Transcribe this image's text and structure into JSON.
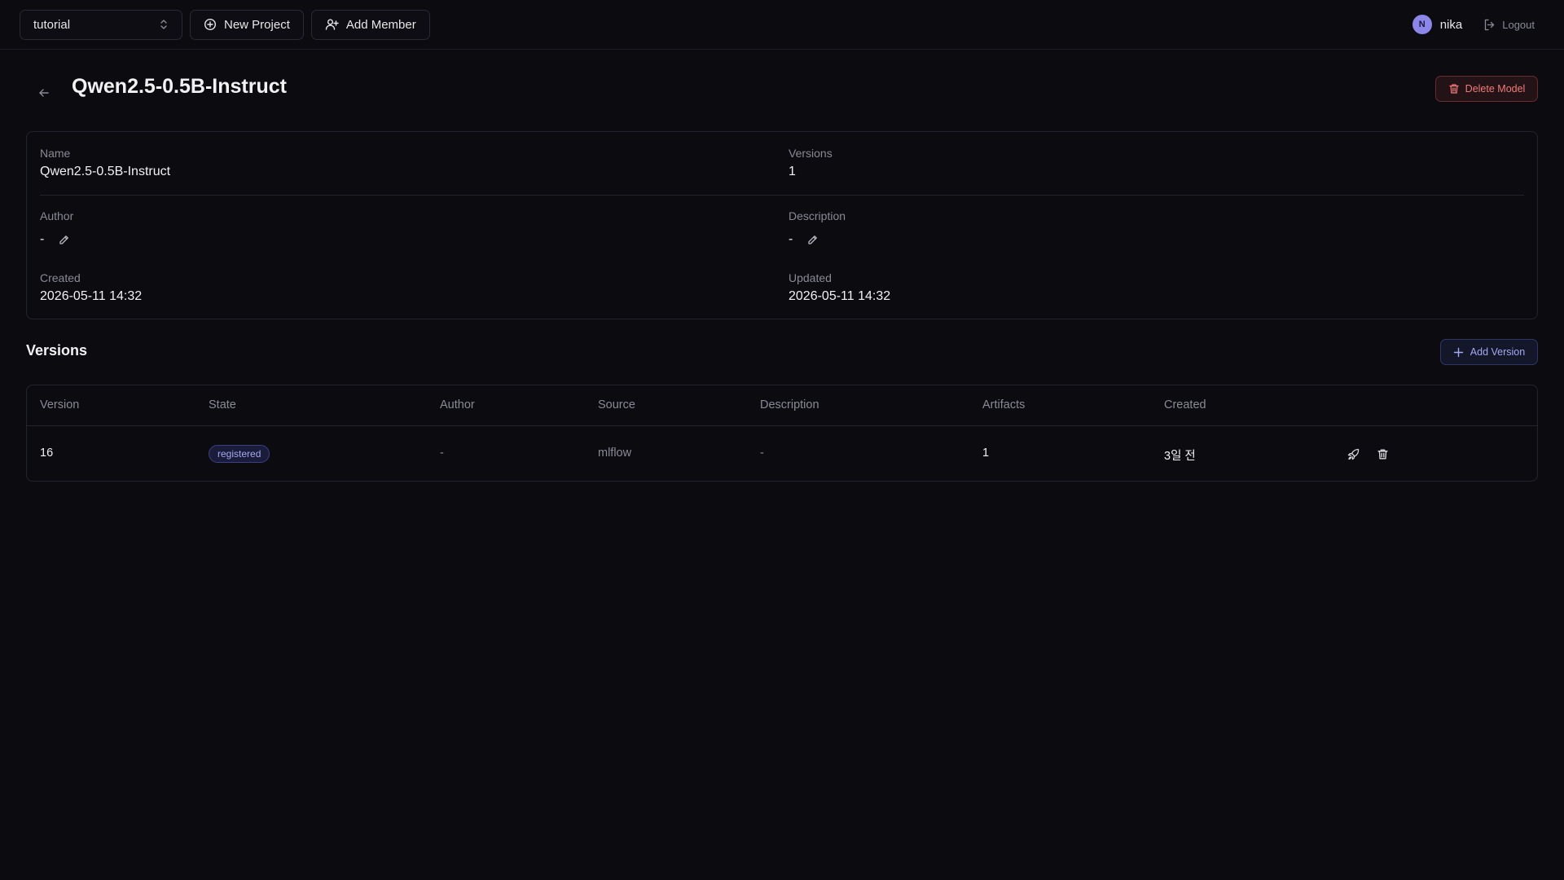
{
  "topbar": {
    "project": "tutorial",
    "new_project_label": "New Project",
    "add_member_label": "Add Member",
    "user": {
      "initial": "N",
      "name": "nika"
    },
    "logout_label": "Logout"
  },
  "header": {
    "title": "Qwen2.5-0.5B-Instruct",
    "delete_label": "Delete Model"
  },
  "info": {
    "name_label": "Name",
    "name_value": "Qwen2.5-0.5B-Instruct",
    "versions_label": "Versions",
    "versions_value": "1",
    "author_label": "Author",
    "author_value": "-",
    "description_label": "Description",
    "description_value": "-",
    "created_label": "Created",
    "created_value": "2026-05-11 14:32",
    "updated_label": "Updated",
    "updated_value": "2026-05-11 14:32"
  },
  "versions": {
    "title": "Versions",
    "add_label": "Add Version",
    "columns": [
      "Version",
      "State",
      "Author",
      "Source",
      "Description",
      "Artifacts",
      "Created"
    ],
    "rows": [
      {
        "version": "16",
        "state": "registered",
        "author": "-",
        "source": "mlflow",
        "description": "-",
        "artifacts": "1",
        "created": "3일 전"
      }
    ]
  },
  "colors": {
    "background": "#0b0b10",
    "accent": "#a4a9f0",
    "danger": "#f07a7a",
    "avatar": "#8b86e8"
  },
  "icons": {
    "project_select": "chevron-up-down-icon",
    "new_project": "plus-circle-icon",
    "add_member": "user-plus-icon",
    "logout": "logout-icon",
    "back": "arrow-left-icon",
    "delete": "trash-icon",
    "edit": "pencil-icon",
    "add_version": "plus-icon",
    "deploy": "rocket-icon",
    "row_delete": "trash-icon"
  }
}
